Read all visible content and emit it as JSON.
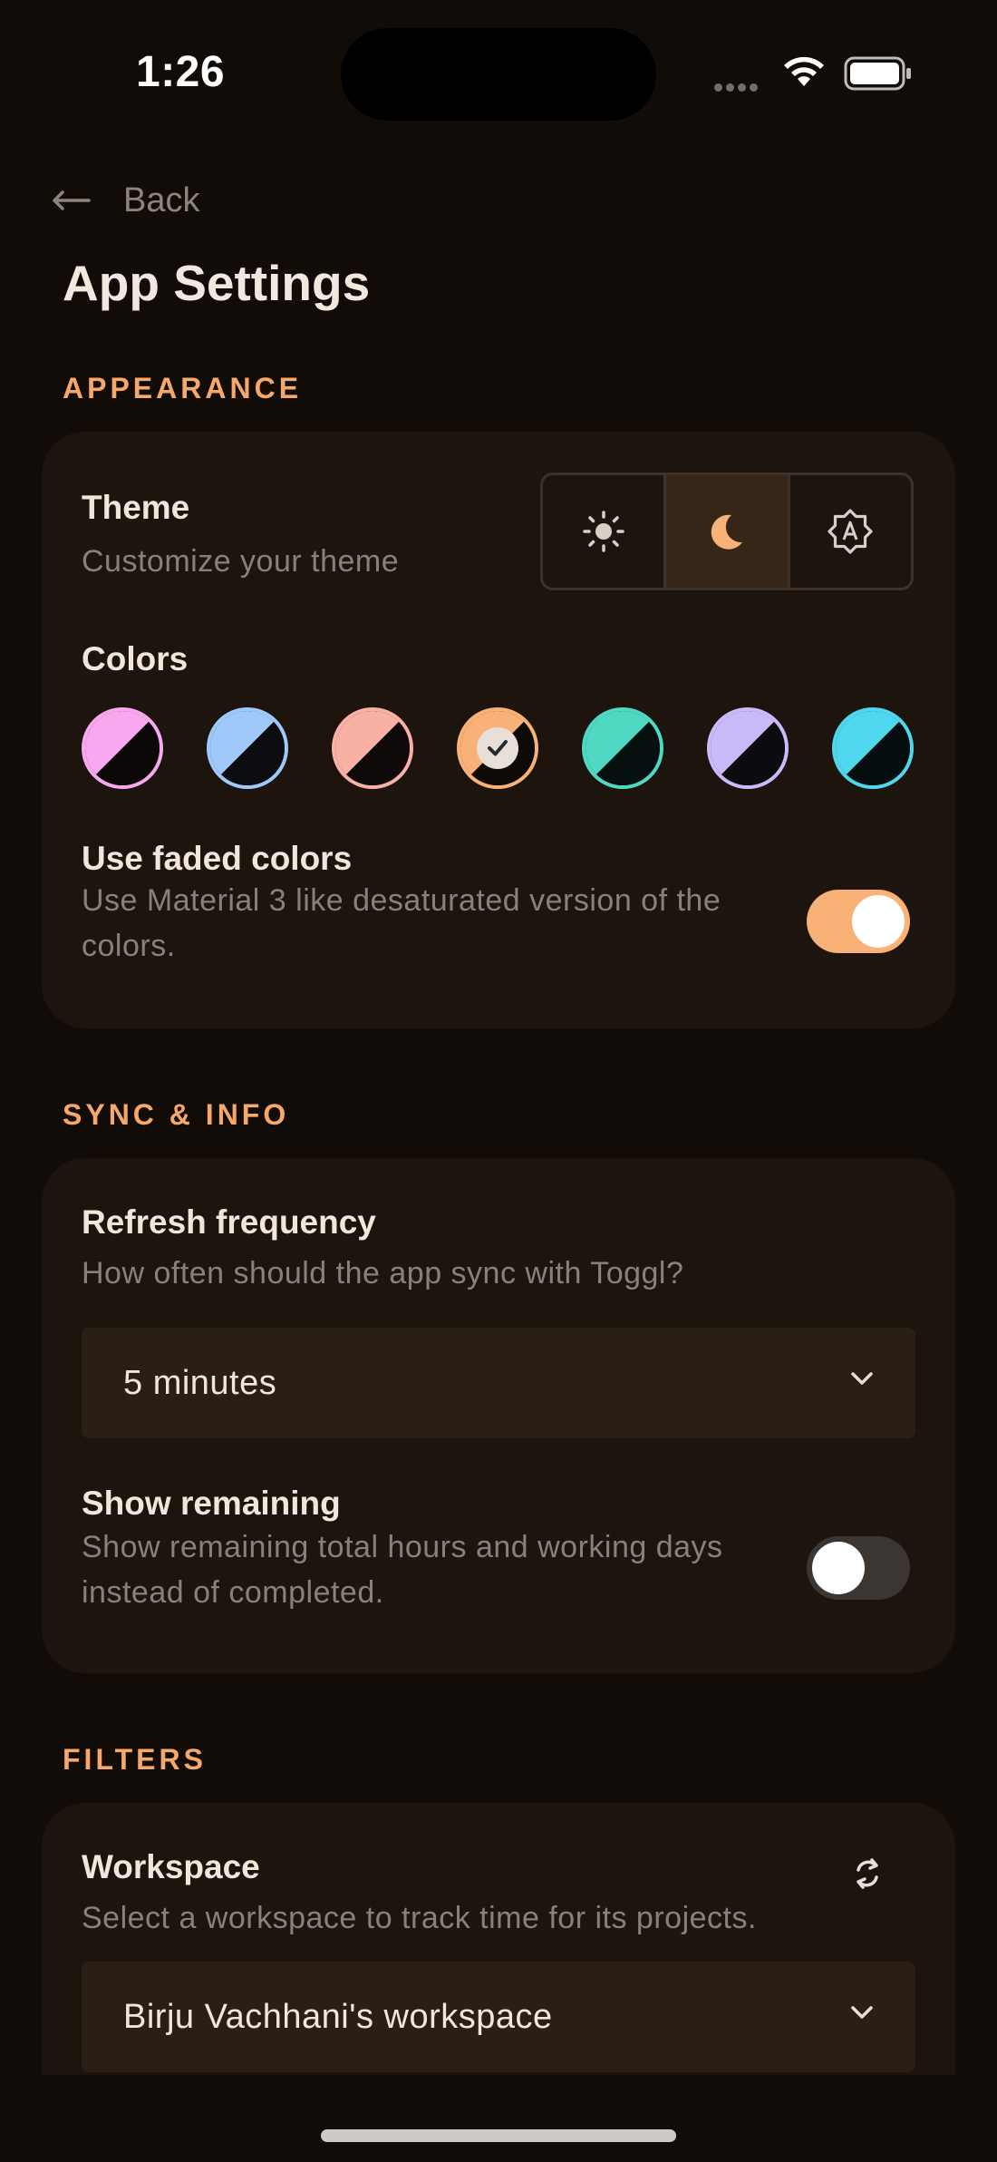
{
  "status_bar": {
    "time": "1:26"
  },
  "header": {
    "back_label": "Back",
    "title": "App Settings"
  },
  "appearance": {
    "section_label": "APPEARANCE",
    "theme": {
      "title": "Theme",
      "subtitle": "Customize your theme",
      "options": [
        "light",
        "dark",
        "auto"
      ],
      "selected": "dark"
    },
    "colors": {
      "title": "Colors",
      "swatches": [
        "#f7a8ee",
        "#9fc9fb",
        "#f9b1a6",
        "#f8b277",
        "#4fd9c3",
        "#cbbafa",
        "#4fd7ee"
      ],
      "selected_index": 3
    },
    "faded": {
      "title": "Use faded colors",
      "subtitle": "Use Material 3 like desaturated version of the colors.",
      "enabled": true
    }
  },
  "sync": {
    "section_label": "SYNC & INFO",
    "refresh": {
      "title": "Refresh frequency",
      "subtitle": "How often should the app sync with Toggl?",
      "value": "5 minutes"
    },
    "remaining": {
      "title": "Show remaining",
      "subtitle": "Show remaining total hours and working days instead of completed.",
      "enabled": false
    }
  },
  "filters": {
    "section_label": "FILTERS",
    "workspace": {
      "title": "Workspace",
      "subtitle": "Select a workspace to track time for its projects.",
      "value": "Birju Vachhani's workspace"
    }
  },
  "colors": {
    "accent": "#f8b277",
    "background": "#120c08",
    "card": "#1c140d",
    "section_label": "#f5a86a"
  }
}
